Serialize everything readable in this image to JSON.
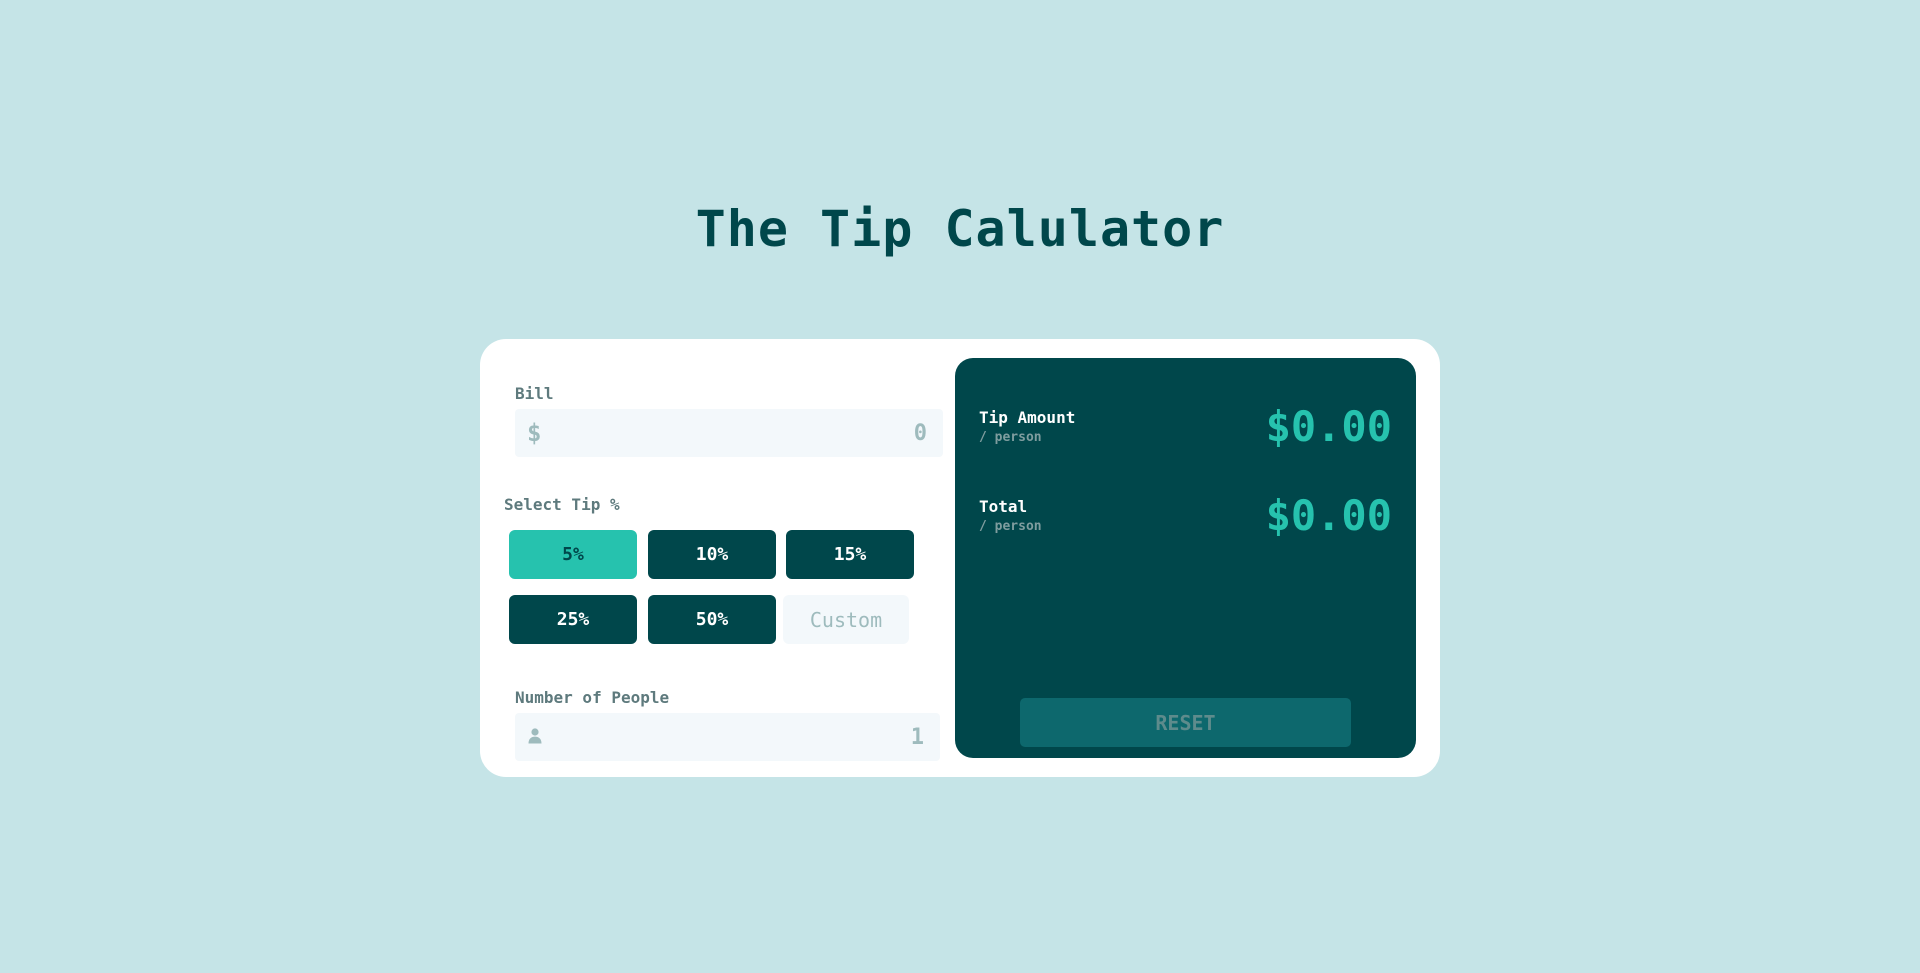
{
  "page": {
    "title": "The Tip Calulator"
  },
  "bill": {
    "label": "Bill",
    "prefix": "$",
    "value": "",
    "placeholder": "0"
  },
  "tip": {
    "label": "Select Tip %",
    "options": [
      {
        "label": "5%",
        "selected": true
      },
      {
        "label": "10%",
        "selected": false
      },
      {
        "label": "15%",
        "selected": false
      },
      {
        "label": "25%",
        "selected": false
      },
      {
        "label": "50%",
        "selected": false
      }
    ],
    "custom_placeholder": "Custom",
    "custom_value": ""
  },
  "people": {
    "label": "Number of People",
    "value": "",
    "placeholder": "1",
    "icon": "person-icon"
  },
  "results": {
    "tip_amount": {
      "label": "Tip Amount",
      "sub": "/ person",
      "value": "$0.00"
    },
    "total": {
      "label": "Total",
      "sub": "/ person",
      "value": "$0.00"
    },
    "reset_label": "RESET"
  },
  "colors": {
    "background": "#c5e4e7",
    "dark_teal": "#00474b",
    "accent": "#26c2ae",
    "input_bg": "#f3f8fb",
    "muted": "#9ebbbd",
    "reset_bg": "#0d686d"
  }
}
